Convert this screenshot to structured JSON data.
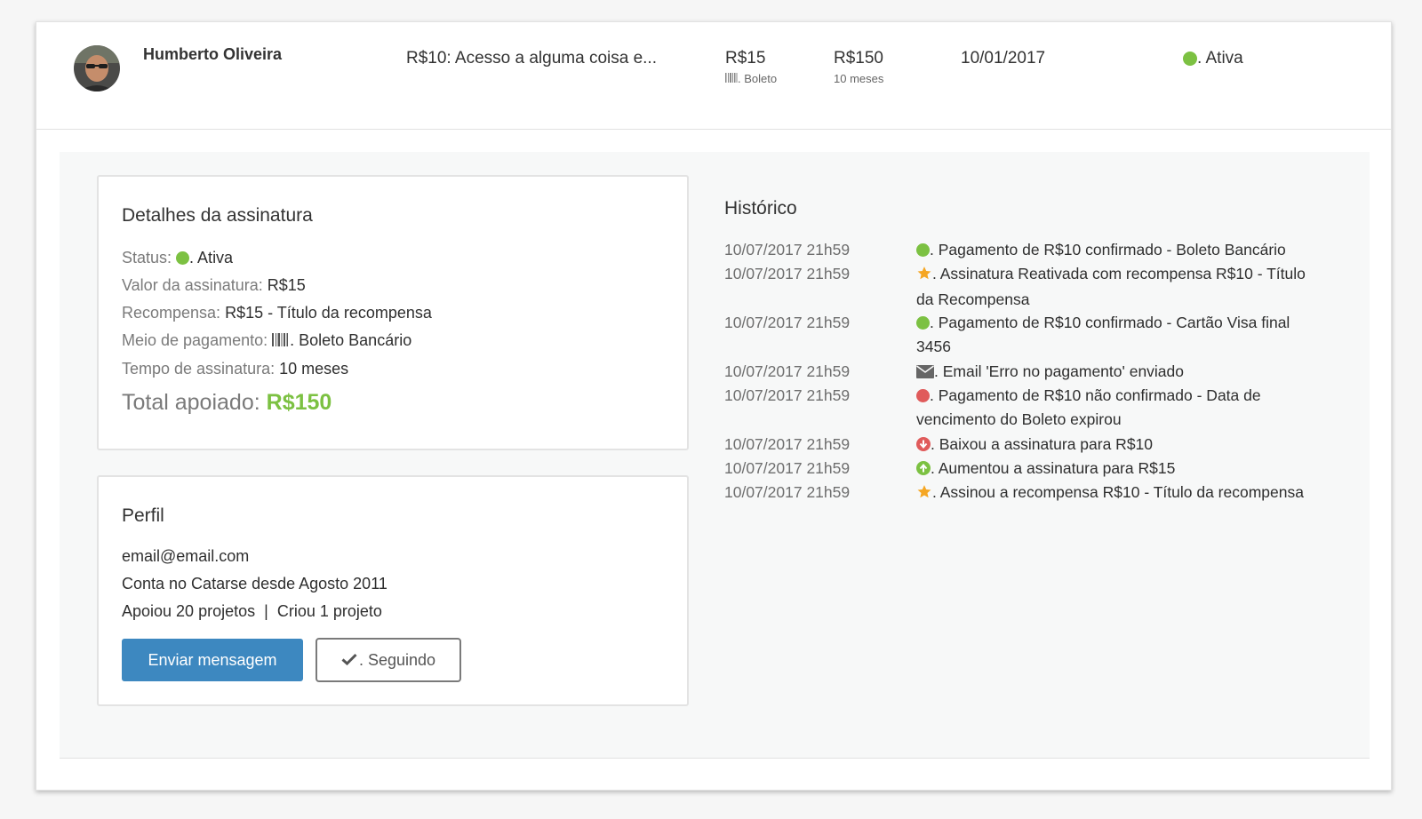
{
  "header": {
    "name": "Humberto Oliveira",
    "reward": "R$10: Acesso a alguma coisa e...",
    "value": "R$15",
    "payment_method": ". Boleto",
    "total": "R$150",
    "duration": "10 meses",
    "date": "10/01/2017",
    "status": ". Ativa"
  },
  "subscription": {
    "title": "Detalhes da assinatura",
    "status_label": "Status:",
    "status_value": ". Ativa",
    "value_label": "Valor da assinatura:",
    "value_value": "R$15",
    "reward_label": "Recompensa:",
    "reward_value": "R$15 - Título da recompensa",
    "payment_label": "Meio de pagamento:",
    "payment_value": ". Boleto Bancário",
    "duration_label": "Tempo de assinatura:",
    "duration_value": "10 meses",
    "total_label": "Total apoiado:",
    "total_value": "R$150"
  },
  "profile": {
    "title": "Perfil",
    "email": "email@email.com",
    "member_since": "Conta no Catarse desde Agosto 2011",
    "backed": "Apoiou 20 projetos",
    "separator": "|",
    "created": "Criou 1 projeto",
    "send_message": "Enviar mensagem",
    "following": ". Seguindo"
  },
  "history": {
    "title": "Histórico",
    "events": [
      {
        "date": "10/07/2017 21h59",
        "icon": "green-dot-icon",
        "text": ". Pagamento de R$10 confirmado - Boleto Bancário"
      },
      {
        "date": "10/07/2017 21h59",
        "icon": "star-icon",
        "text": ". Assinatura Reativada com recompensa R$10 - Título da Recompensa"
      },
      {
        "date": "10/07/2017 21h59",
        "icon": "green-dot-icon",
        "text": ". Pagamento de R$10 confirmado - Cartão Visa final 3456"
      },
      {
        "date": "10/07/2017 21h59",
        "icon": "envelope-icon",
        "text": ". Email 'Erro no pagamento' enviado"
      },
      {
        "date": "10/07/2017 21h59",
        "icon": "red-dot-icon",
        "text": ". Pagamento de R$10 não confirmado - Data de vencimento do Boleto expirou"
      },
      {
        "date": "10/07/2017 21h59",
        "icon": "arrow-down-circle-icon",
        "text": ". Baixou a assinatura para R$10"
      },
      {
        "date": "10/07/2017 21h59",
        "icon": "arrow-up-circle-icon",
        "text": ". Aumentou a assinatura para R$15"
      },
      {
        "date": "10/07/2017 21h59",
        "icon": "star-icon",
        "text": ". Assinou a recompensa R$10 - Título da recompensa"
      }
    ]
  },
  "colors": {
    "active_green": "#7cc142",
    "error_red": "#e05b5b",
    "star_orange": "#f5a623",
    "button_blue": "#3d88c0"
  }
}
